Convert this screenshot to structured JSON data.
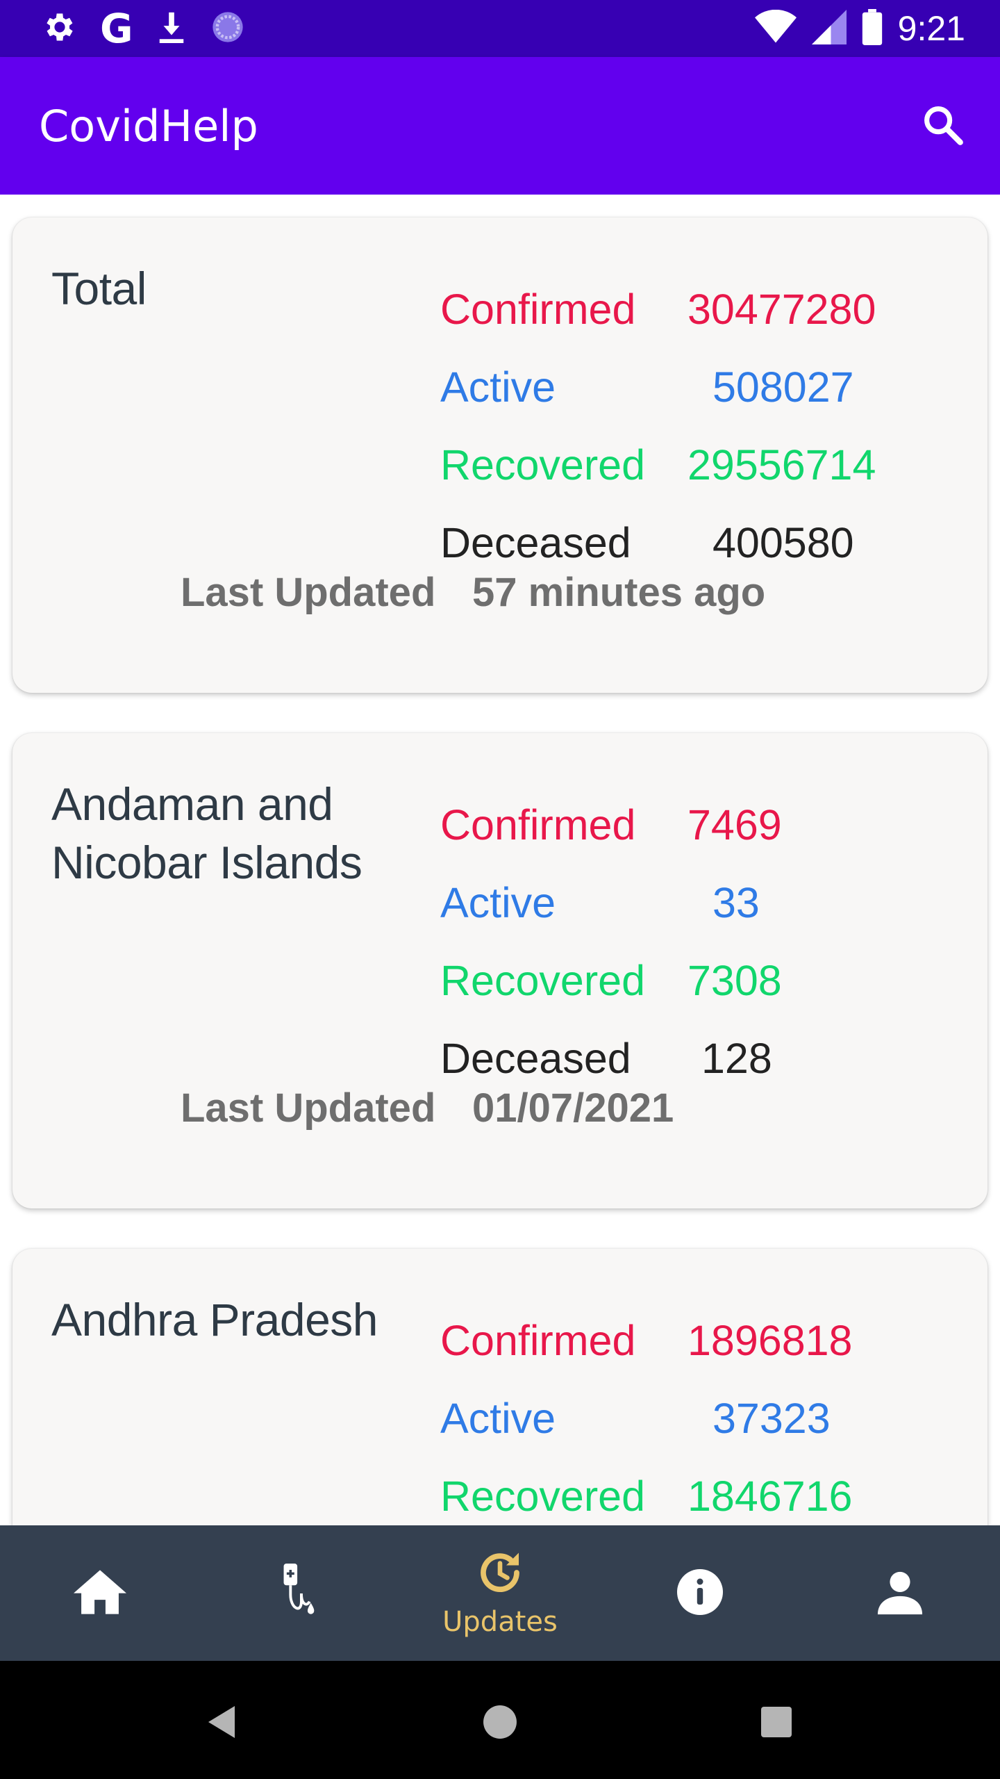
{
  "status_bar": {
    "time": "9:21",
    "g_label": "G",
    "left_icons": [
      "gear-icon",
      "google-icon",
      "download-icon",
      "loader-icon"
    ],
    "right_icons": [
      "wifi-icon",
      "signal-icon",
      "battery-icon"
    ]
  },
  "app_bar": {
    "title": "CovidHelp",
    "search_icon": "search-icon"
  },
  "cards": [
    {
      "name": "Total",
      "confirmed_label": "Confirmed",
      "confirmed": "30477280",
      "active_label": "Active",
      "active": "508027",
      "recovered_label": "Recovered",
      "recovered": "29556714",
      "deceased_label": "Deceased",
      "deceased": "400580",
      "updated_label": "Last Updated",
      "updated": "57 minutes ago"
    },
    {
      "name": "Andaman and Nicobar Islands",
      "confirmed_label": "Confirmed",
      "confirmed": "7469",
      "active_label": "Active",
      "active": "33",
      "recovered_label": "Recovered",
      "recovered": "7308",
      "deceased_label": "Deceased",
      "deceased": "128",
      "updated_label": "Last Updated",
      "updated": "01/07/2021"
    },
    {
      "name": "Andhra Pradesh",
      "confirmed_label": "Confirmed",
      "confirmed": "1896818",
      "active_label": "Active",
      "active": "37323",
      "recovered_label": "Recovered",
      "recovered": "1846716"
    }
  ],
  "bottom_nav": {
    "items": [
      {
        "icon": "home-icon",
        "label": ""
      },
      {
        "icon": "iv-drip-icon",
        "label": ""
      },
      {
        "icon": "updates-icon",
        "label": "Updates",
        "selected": true
      },
      {
        "icon": "info-icon",
        "label": ""
      },
      {
        "icon": "person-icon",
        "label": ""
      }
    ],
    "active_color": "#e9c46a",
    "background": "#344050"
  },
  "colors": {
    "status_bar": "#3700b3",
    "app_bar": "#6200ee",
    "confirmed": "#e8174a",
    "active": "#2f7be6",
    "recovered": "#11d66c",
    "deceased": "#222222"
  }
}
